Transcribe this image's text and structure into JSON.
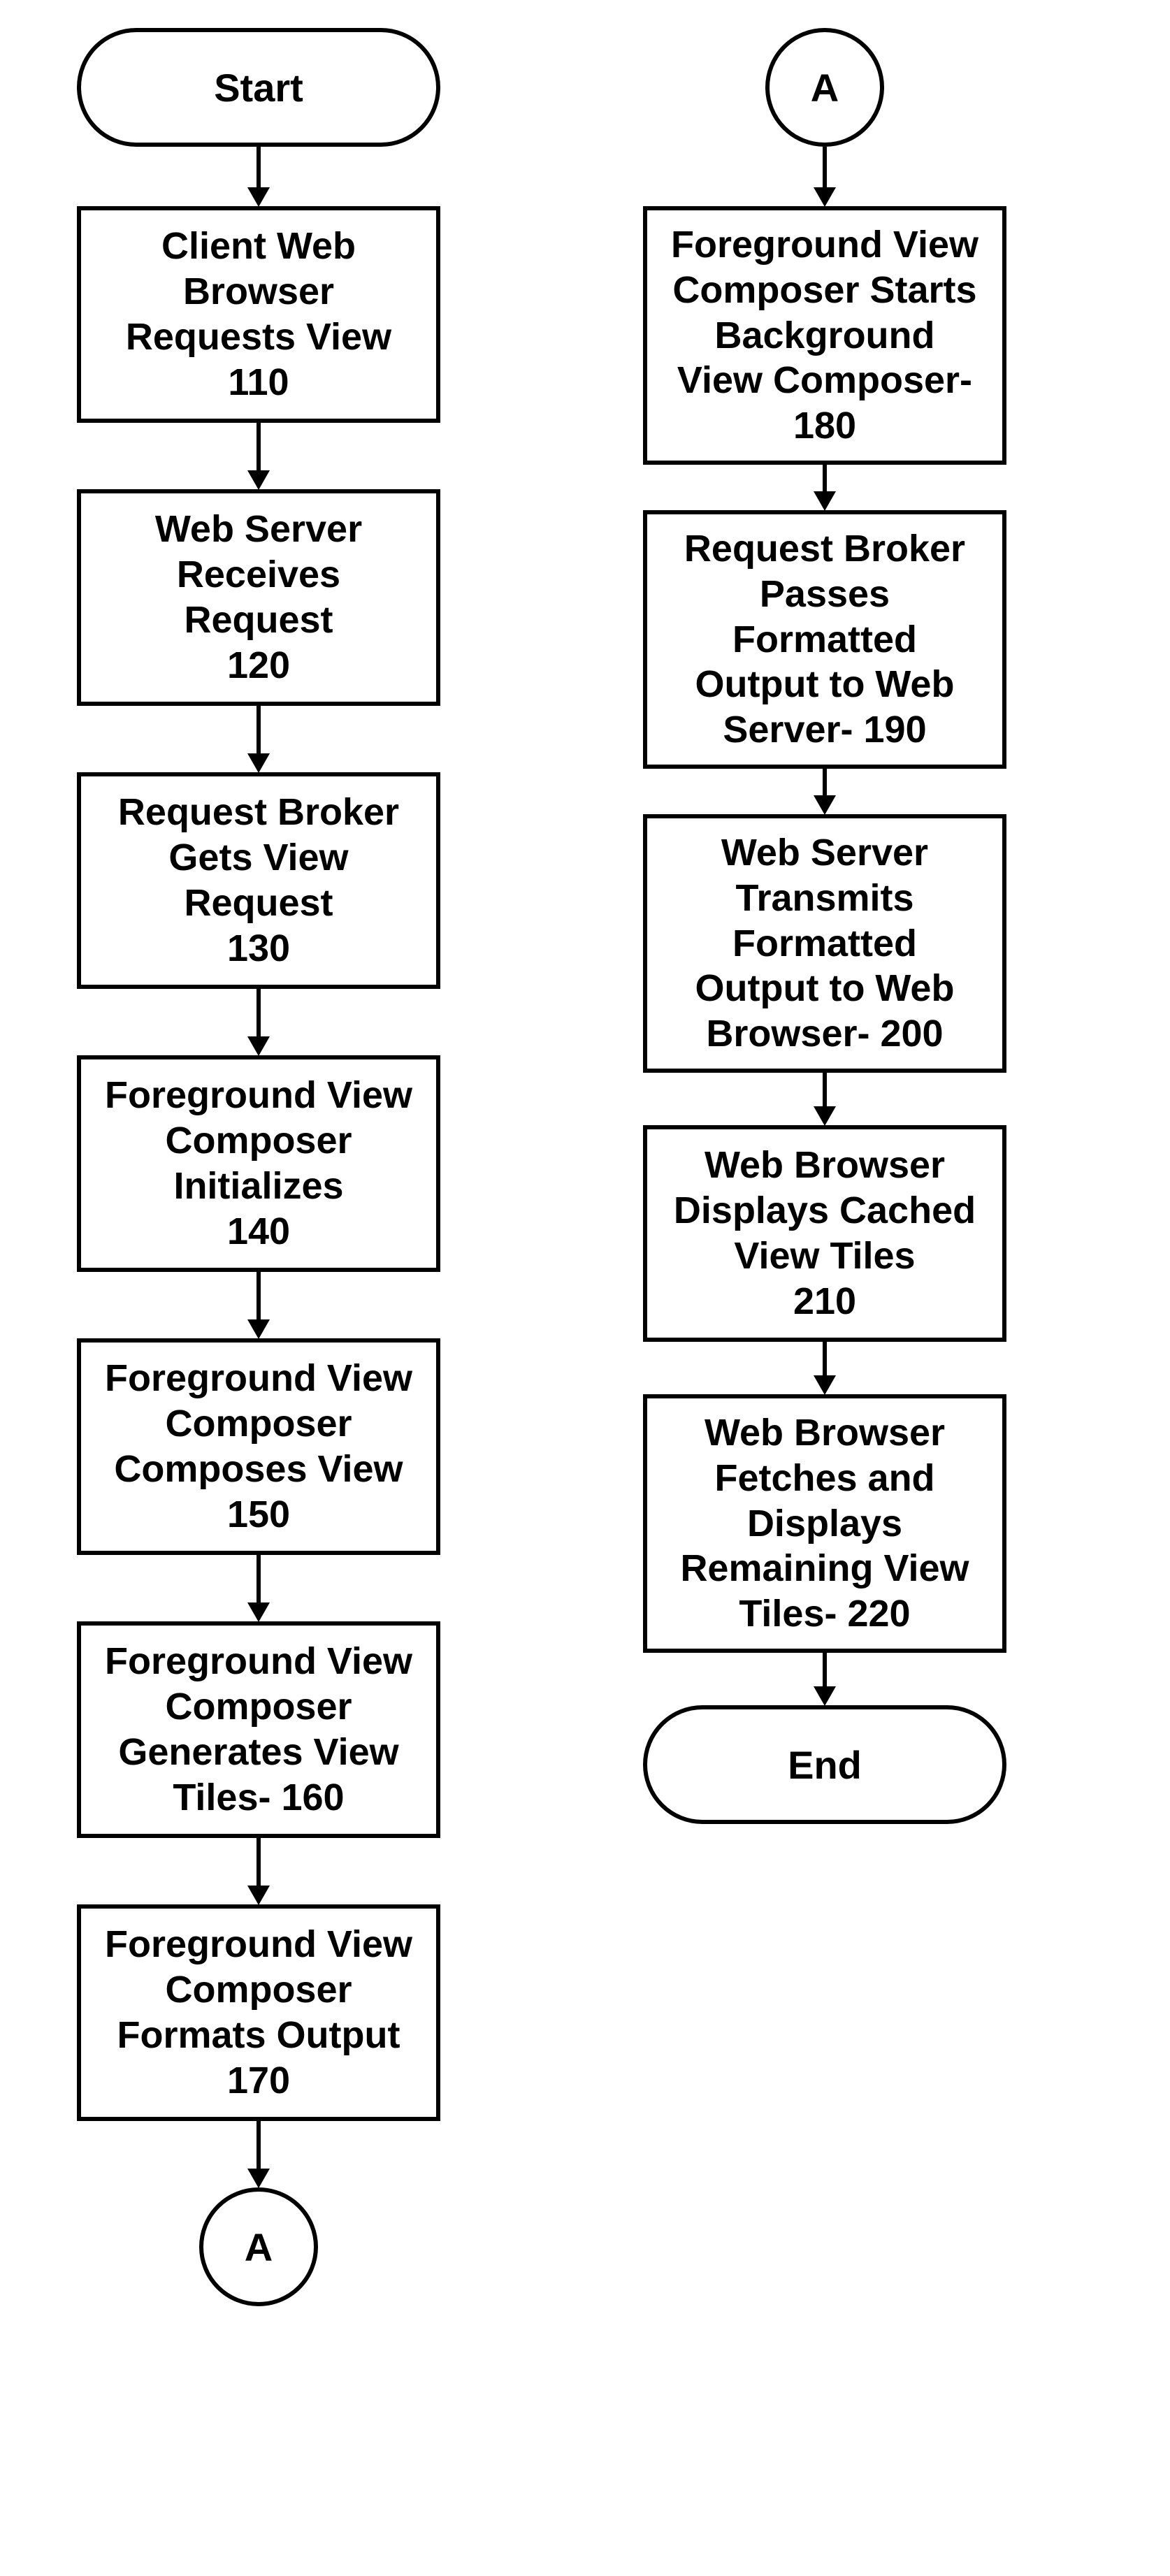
{
  "start": {
    "label": "Start"
  },
  "end": {
    "label": "End"
  },
  "connectorA": {
    "label": "A"
  },
  "left": {
    "step110": {
      "text": "Client Web\nBrowser\nRequests View\n110"
    },
    "step120": {
      "text": "Web Server\nReceives\nRequest\n120"
    },
    "step130": {
      "text": "Request Broker\nGets View\nRequest\n130"
    },
    "step140": {
      "text": "Foreground View\nComposer\nInitializes\n140"
    },
    "step150": {
      "text": "Foreground View\nComposer\nComposes View\n150"
    },
    "step160": {
      "text": "Foreground View\nComposer\nGenerates View\nTiles-  160"
    },
    "step170": {
      "text": "Foreground View\nComposer\nFormats Output\n170"
    }
  },
  "right": {
    "step180": {
      "text": "Foreground View\nComposer Starts\nBackground\nView Composer-\n180"
    },
    "step190": {
      "text": "Request Broker\nPasses\nFormatted\nOutput to Web\nServer-  190"
    },
    "step200": {
      "text": "Web Server\nTransmits\nFormatted\nOutput to Web\nBrowser-  200"
    },
    "step210": {
      "text": "Web Browser\nDisplays Cached\nView Tiles\n210"
    },
    "step220": {
      "text": "Web Browser\nFetches and\nDisplays\nRemaining View\nTiles-   220"
    }
  }
}
